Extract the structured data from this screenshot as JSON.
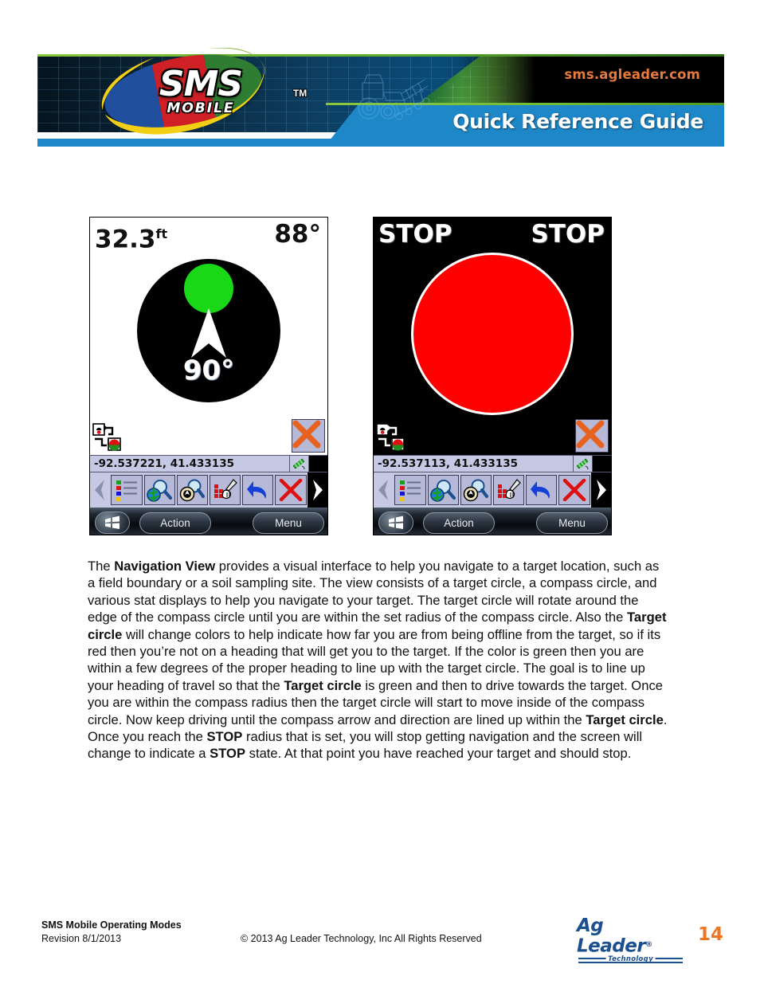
{
  "header": {
    "url": "sms.agleader.com",
    "guide_title": "Quick Reference Guide",
    "logo_main": "SMS",
    "logo_tm": "TM",
    "logo_sub": "MOBILE"
  },
  "devices": [
    {
      "name": "navigation-view",
      "stat_left": "32.3",
      "stat_left_unit": "ft",
      "stat_right": "88°",
      "heading": "90°",
      "target_circle_color": "#18d818",
      "coords": "-92.537221, 41.433135",
      "softkey_action": "Action",
      "softkey_menu": "Menu"
    },
    {
      "name": "stop-view",
      "stat_left": "STOP",
      "stat_left_unit": "",
      "stat_right": "STOP",
      "heading": "",
      "target_circle_color": "#fe0000",
      "coords": "-92.537113, 41.433135",
      "softkey_action": "Action",
      "softkey_menu": "Menu"
    }
  ],
  "toolbar_icons": [
    "legend-list-icon",
    "zoom-to-world-icon",
    "zoom-to-extent-icon",
    "manual-point-icon",
    "undo-icon",
    "close-red-x-icon"
  ],
  "body": {
    "paragraph_html": "The <b>Navigation View</b> provides a visual interface to help you navigate to a target location, such as a field boundary or a soil sampling site. The view consists of a target circle, a compass circle, and various stat displays to help you navigate to your target. The target circle will rotate around the edge of the compass circle until you are within the set radius of the compass circle. Also the <b>Target circle</b> will change colors to help indicate how far you are from being offline from the target, so if its red then you&rsquo;re not on a heading that will get you to the target. If the color is green then you are within a few degrees of the proper heading to line up with the target circle. The goal is to line up your heading of travel so that the <b>Target circle</b> is green and then to drive towards the target. Once you are within the compass radius then the target circle will start to move inside of the compass circle. Now keep driving until the compass arrow and direction are lined up within the <b>Target circle</b>. Once you reach the <b>STOP</b> radius that is set, you will stop getting navigation and the screen will change to indicate a <b>STOP</b> state. At that point you have reached your target and should stop."
  },
  "footer": {
    "title": "SMS Mobile Operating Modes",
    "revision": "Revision 8/1/2013",
    "copyright": "© 2013 Ag Leader Technology, Inc  All Rights Reserved",
    "logo_main": "Ag Leader",
    "logo_reg": "®",
    "logo_sub": "Technology",
    "page_number": "14"
  },
  "colors": {
    "header_blue": "#1e87c8",
    "header_green": "#8bc63f",
    "url_orange": "#e8793b",
    "page_orange": "#ef7622",
    "logo_blue": "#1b4f8f",
    "target_green": "#18d818",
    "stop_red": "#fe0000"
  }
}
